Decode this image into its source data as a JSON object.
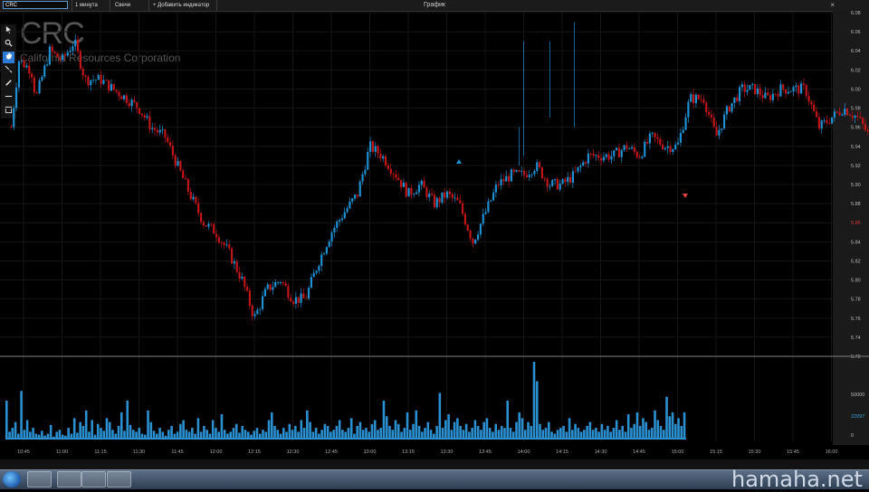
{
  "toolbar": {
    "symbol": "CRC",
    "timeframe": "1 минута",
    "chart_type": "Свечи",
    "add_indicator": "+ Добавить индикатор",
    "window_title": "График",
    "close_glyph": "×"
  },
  "tools": [
    "cursor-icon",
    "zoom-icon",
    "hand-icon",
    "line-icon",
    "pen-icon",
    "horizontal-line-icon",
    "rectangle-icon"
  ],
  "header": {
    "ticker": "CRC",
    "company": "California Resources Corporation"
  },
  "colors": {
    "up": "#1f8fd0",
    "down": "#c0161a",
    "bg": "#000000",
    "grid": "#151515",
    "volume": "#2b8fd0"
  },
  "chart_data": {
    "type": "candlestick",
    "ylim": [
      5.72,
      6.08
    ],
    "price_ticks": [
      "6.08",
      "6.06",
      "6.04",
      "6.02",
      "6.00",
      "5.98",
      "5.96",
      "5.94",
      "5.92",
      "5.90",
      "5.88",
      "5.86",
      "5.84",
      "5.82",
      "5.80",
      "5.78",
      "5.76",
      "5.74",
      "5.72"
    ],
    "current_price": "5.86",
    "volume_ticks": [
      "50000",
      "22097",
      "0"
    ],
    "time_ticks": [
      "10:45",
      "11:00",
      "11:15",
      "11:30",
      "11:45",
      "12:00",
      "12:15",
      "12:30",
      "12:45",
      "13:00",
      "13:15",
      "13:30",
      "13:45",
      "14:00",
      "14:15",
      "14:30",
      "14:45",
      "15:00",
      "15:15",
      "15:30",
      "15:45",
      "16:00"
    ],
    "price_path": [
      [
        10.67,
        5.96
      ],
      [
        10.72,
        6.03
      ],
      [
        10.8,
        6.02
      ],
      [
        10.83,
        5.99
      ],
      [
        10.92,
        6.04
      ],
      [
        11.0,
        6.03
      ],
      [
        11.08,
        6.05
      ],
      [
        11.15,
        6.01
      ],
      [
        11.25,
        6.01
      ],
      [
        11.33,
        6.0
      ],
      [
        11.42,
        5.99
      ],
      [
        11.5,
        5.98
      ],
      [
        11.58,
        5.96
      ],
      [
        11.67,
        5.95
      ],
      [
        11.75,
        5.92
      ],
      [
        11.83,
        5.89
      ],
      [
        11.92,
        5.86
      ],
      [
        12.0,
        5.85
      ],
      [
        12.08,
        5.83
      ],
      [
        12.17,
        5.8
      ],
      [
        12.25,
        5.76
      ],
      [
        12.33,
        5.79
      ],
      [
        12.42,
        5.8
      ],
      [
        12.5,
        5.78
      ],
      [
        12.58,
        5.78
      ],
      [
        12.67,
        5.82
      ],
      [
        12.75,
        5.85
      ],
      [
        12.83,
        5.87
      ],
      [
        12.92,
        5.89
      ],
      [
        13.0,
        5.94
      ],
      [
        13.08,
        5.93
      ],
      [
        13.17,
        5.91
      ],
      [
        13.25,
        5.89
      ],
      [
        13.33,
        5.9
      ],
      [
        13.42,
        5.88
      ],
      [
        13.5,
        5.89
      ],
      [
        13.58,
        5.88
      ],
      [
        13.67,
        5.84
      ],
      [
        13.75,
        5.87
      ],
      [
        13.83,
        5.9
      ],
      [
        13.92,
        5.91
      ],
      [
        14.0,
        5.91
      ],
      [
        14.08,
        5.92
      ],
      [
        14.17,
        5.9
      ],
      [
        14.25,
        5.9
      ],
      [
        14.33,
        5.91
      ],
      [
        14.42,
        5.93
      ],
      [
        14.5,
        5.93
      ],
      [
        14.58,
        5.93
      ],
      [
        14.67,
        5.94
      ],
      [
        14.75,
        5.93
      ],
      [
        14.83,
        5.95
      ],
      [
        14.92,
        5.94
      ],
      [
        15.0,
        5.94
      ],
      [
        15.08,
        5.99
      ],
      [
        15.17,
        5.99
      ],
      [
        15.25,
        5.95
      ],
      [
        15.33,
        5.98
      ],
      [
        15.42,
        6.0
      ],
      [
        15.5,
        6.0
      ],
      [
        15.58,
        5.99
      ],
      [
        15.67,
        6.0
      ],
      [
        15.75,
        6.0
      ],
      [
        15.83,
        6.0
      ],
      [
        15.92,
        5.96
      ],
      [
        16.0,
        5.97
      ],
      [
        16.08,
        5.98
      ],
      [
        16.17,
        5.97
      ],
      [
        16.25,
        5.95
      ],
      [
        16.33,
        5.95
      ],
      [
        16.42,
        5.95
      ],
      [
        16.5,
        5.95
      ],
      [
        16.58,
        5.92
      ],
      [
        16.67,
        5.9
      ],
      [
        16.75,
        5.89
      ],
      [
        16.83,
        5.87
      ]
    ],
    "volume_series": [
      40,
      8,
      12,
      18,
      6,
      50,
      10,
      20,
      8,
      12,
      6,
      5,
      9,
      4,
      6,
      15,
      3,
      8,
      10,
      5,
      4,
      12,
      6,
      22,
      7,
      18,
      14,
      30,
      8,
      20,
      5,
      16,
      12,
      9,
      22,
      18,
      10,
      6,
      14,
      28,
      9,
      40,
      15,
      10,
      8,
      12,
      6,
      5,
      30,
      18,
      9,
      6,
      12,
      8,
      4,
      10,
      14,
      6,
      8,
      16,
      20,
      10,
      8,
      12,
      6,
      22,
      8,
      14,
      10,
      6,
      20,
      12,
      8,
      26,
      10,
      6,
      8,
      12,
      16,
      7,
      14,
      10,
      8,
      5,
      9,
      12,
      6,
      10,
      8,
      20,
      28,
      14,
      10,
      6,
      12,
      8,
      16,
      10,
      14,
      8,
      20,
      12,
      30,
      18,
      8,
      12,
      6,
      10,
      16,
      14,
      8,
      10,
      14,
      20,
      10,
      8,
      12,
      22,
      6,
      14,
      18,
      10,
      12,
      8,
      16,
      20,
      10,
      12,
      40,
      24,
      14,
      10,
      20,
      16,
      8,
      12,
      28,
      10,
      16,
      30,
      14,
      8,
      12,
      18,
      10,
      6,
      14,
      48,
      12,
      20,
      26,
      10,
      18,
      22,
      14,
      10,
      16,
      8,
      12,
      20,
      14,
      10,
      18,
      22,
      12,
      8,
      16,
      10,
      14,
      12,
      40,
      12,
      8,
      18,
      28,
      22,
      10,
      18,
      14,
      80,
      60,
      16,
      10,
      12,
      18,
      8,
      6,
      10,
      12,
      14,
      8,
      22,
      10,
      16,
      12,
      8,
      10,
      14,
      18,
      10,
      12,
      8,
      16,
      10,
      14,
      8,
      12,
      20,
      10,
      14,
      8,
      26,
      12,
      16,
      28,
      14,
      22,
      18,
      10,
      12,
      30,
      20,
      14,
      10,
      44,
      24,
      28,
      16,
      22,
      14,
      28
    ]
  }
}
